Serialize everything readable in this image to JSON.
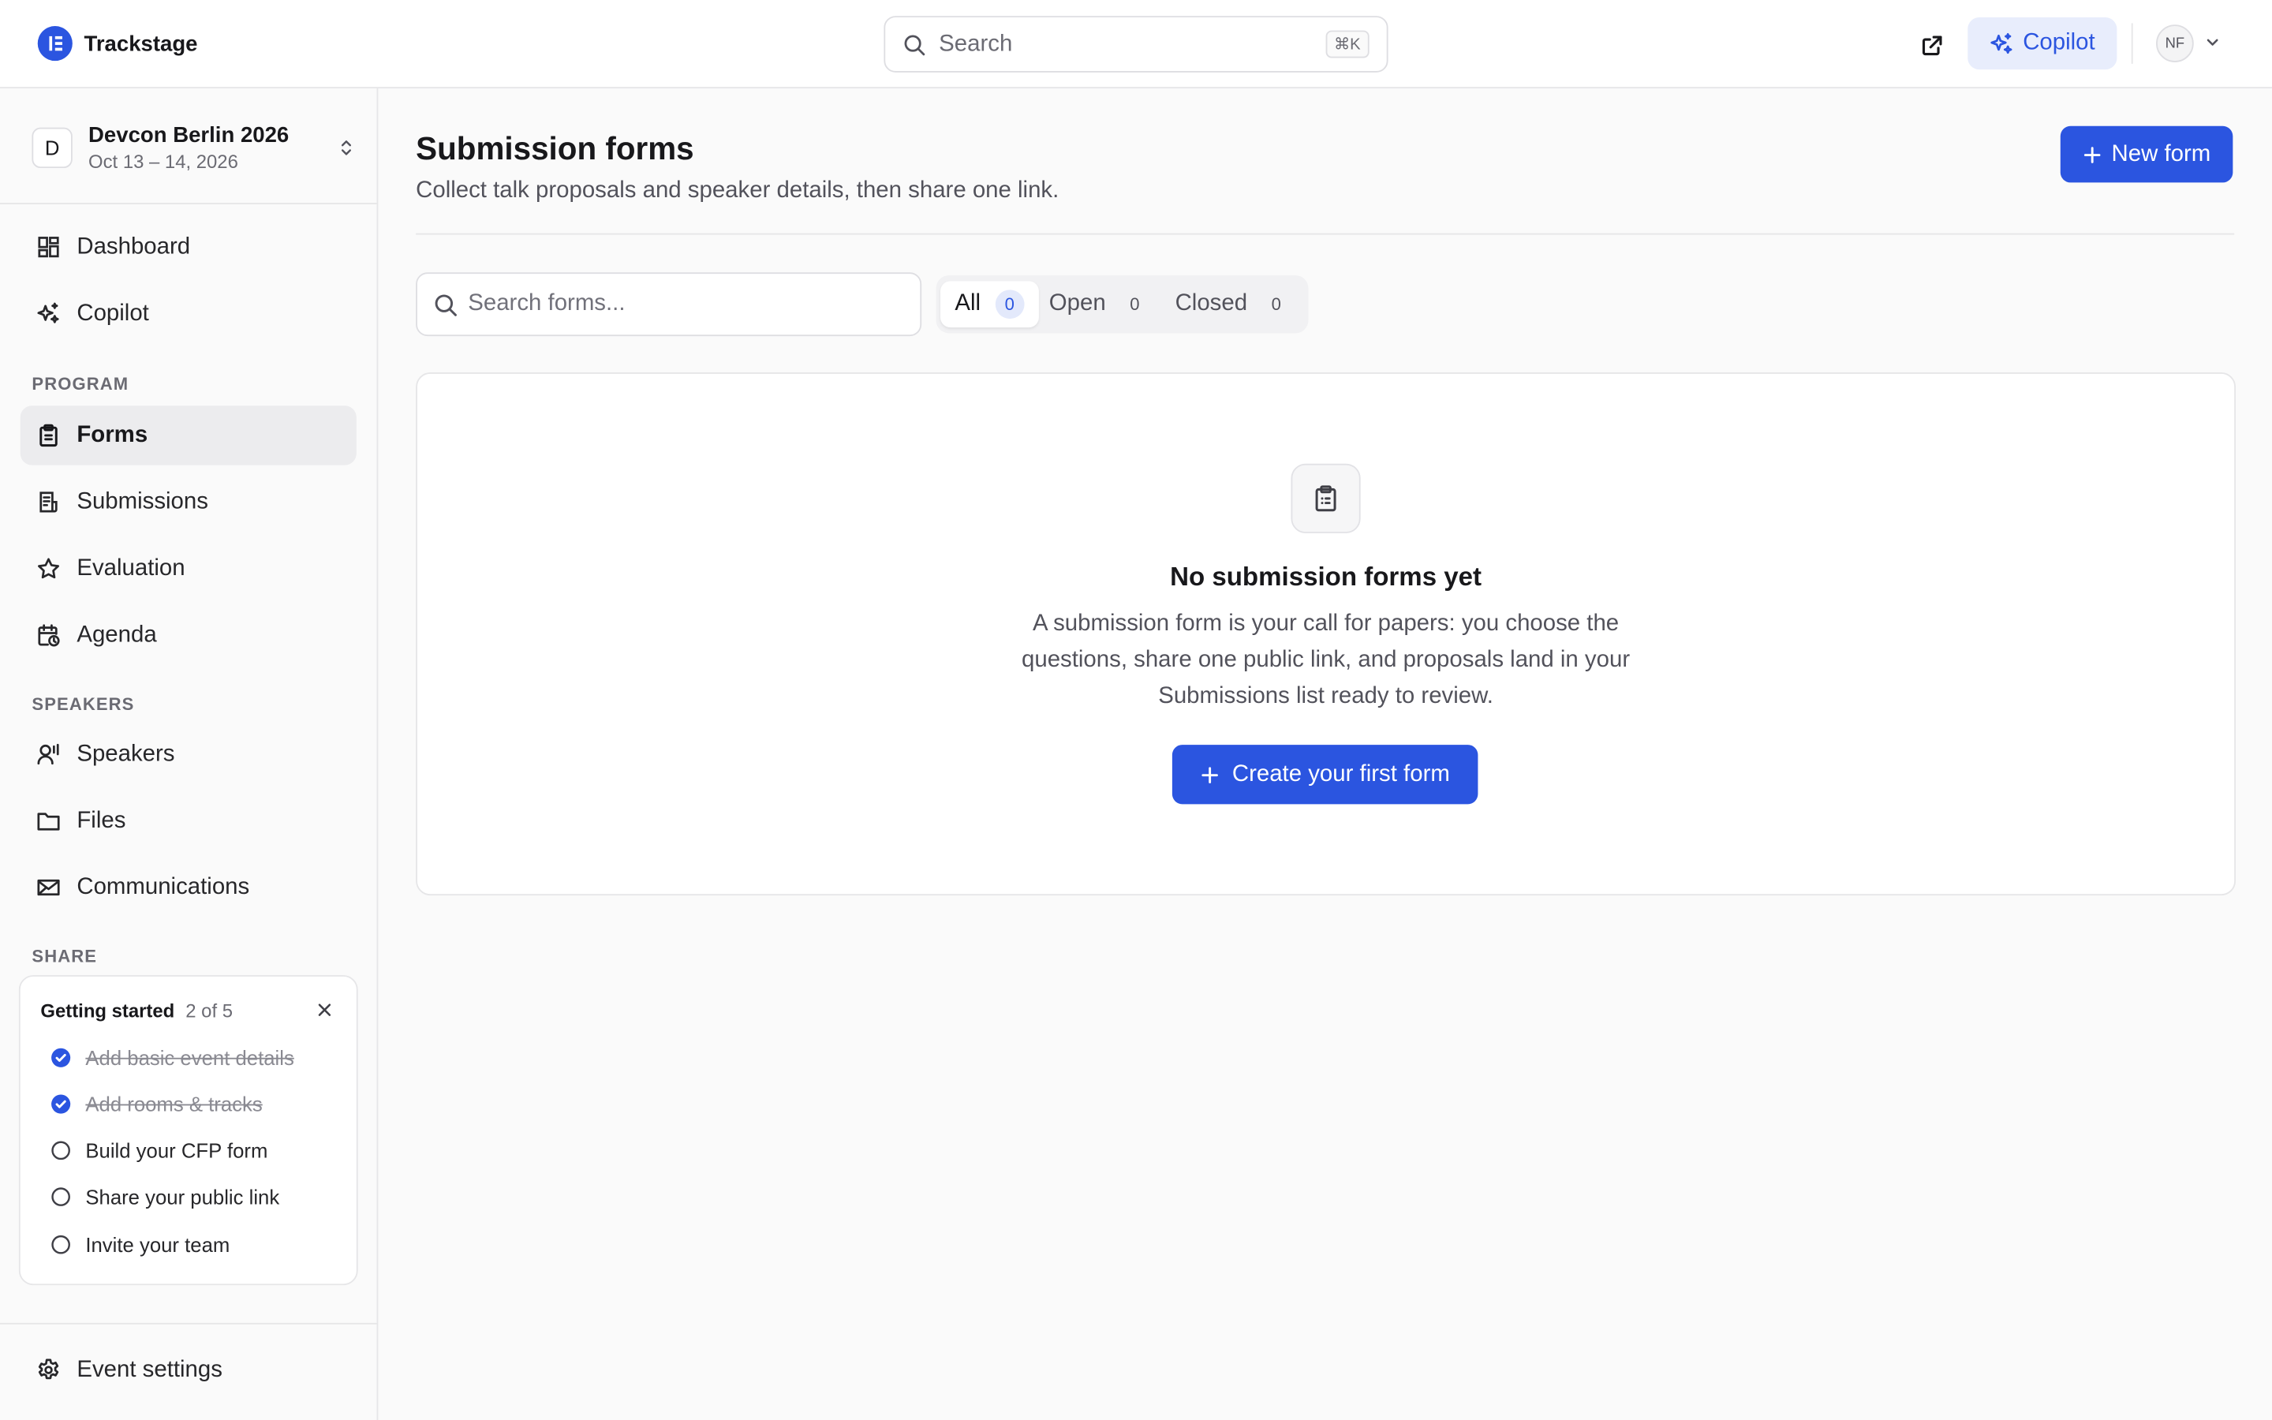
{
  "app": {
    "name": "Trackstage"
  },
  "topbar": {
    "search_placeholder": "Search",
    "search_shortcut": "⌘K",
    "copilot_label": "Copilot",
    "avatar_initials": "NF"
  },
  "event": {
    "badge": "D",
    "name": "Devcon Berlin 2026",
    "dates": "Oct 13 – 14, 2026"
  },
  "sidebar": {
    "top_items": [
      {
        "label": "Dashboard",
        "icon": "dashboard-icon"
      },
      {
        "label": "Copilot",
        "icon": "sparkles-icon"
      }
    ],
    "sections": {
      "program": {
        "label": "PROGRAM",
        "items": [
          {
            "label": "Forms",
            "icon": "clipboard-icon",
            "active": true
          },
          {
            "label": "Submissions",
            "icon": "document-list-icon"
          },
          {
            "label": "Evaluation",
            "icon": "star-icon"
          },
          {
            "label": "Agenda",
            "icon": "calendar-clock-icon"
          }
        ]
      },
      "speakers": {
        "label": "SPEAKERS",
        "items": [
          {
            "label": "Speakers",
            "icon": "user-voice-icon"
          },
          {
            "label": "Files",
            "icon": "folder-icon"
          },
          {
            "label": "Communications",
            "icon": "mail-send-icon"
          }
        ]
      },
      "share": {
        "label": "SHARE"
      }
    },
    "getting_started": {
      "title": "Getting started",
      "progress": "2 of 5",
      "items": [
        {
          "label": "Add basic event details",
          "done": true
        },
        {
          "label": "Add rooms & tracks",
          "done": true
        },
        {
          "label": "Build your CFP form",
          "done": false
        },
        {
          "label": "Share your public link",
          "done": false
        },
        {
          "label": "Invite your team",
          "done": false
        }
      ]
    },
    "footer_item": {
      "label": "Event settings",
      "icon": "gear-icon"
    }
  },
  "main": {
    "title": "Submission forms",
    "subtitle": "Collect talk proposals and speaker details, then share one link.",
    "new_button": "New form",
    "search_placeholder": "Search forms...",
    "filters": [
      {
        "label": "All",
        "count": "0",
        "active": true
      },
      {
        "label": "Open",
        "count": "0",
        "active": false
      },
      {
        "label": "Closed",
        "count": "0",
        "active": false
      }
    ],
    "empty": {
      "title": "No submission forms yet",
      "description": "A submission form is your call for papers: you choose the questions, share one public link, and proposals land in your Submissions list ready to review.",
      "button": "Create your first form"
    }
  },
  "colors": {
    "accent": "#2b55e0",
    "accent_soft": "#e8edfc",
    "border": "#e6e6e8",
    "background": "#fafafa"
  }
}
